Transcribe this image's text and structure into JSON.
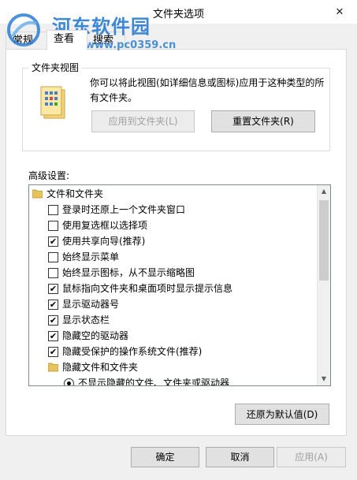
{
  "window": {
    "title": "文件夹选项",
    "close_glyph": "✕"
  },
  "watermark": {
    "text": "河东软件园",
    "url": "www.pc0359.cn"
  },
  "tabs": [
    {
      "label": "常规",
      "active": false
    },
    {
      "label": "查看",
      "active": true
    },
    {
      "label": "搜索",
      "active": false
    }
  ],
  "folder_views": {
    "legend": "文件夹视图",
    "description": "你可以将此视图(如详细信息或图标)应用于这种类型的所有文件夹。",
    "apply_button": "应用到文件夹(L)",
    "reset_button": "重置文件夹(R)"
  },
  "advanced": {
    "label": "高级设置:",
    "items": [
      {
        "type": "folder",
        "label": "文件和文件夹"
      },
      {
        "type": "checkbox",
        "label": "登录时还原上一个文件夹窗口",
        "checked": false
      },
      {
        "type": "checkbox",
        "label": "使用复选框以选择项",
        "checked": false
      },
      {
        "type": "checkbox",
        "label": "使用共享向导(推荐)",
        "checked": true
      },
      {
        "type": "checkbox",
        "label": "始终显示菜单",
        "checked": false
      },
      {
        "type": "checkbox",
        "label": "始终显示图标，从不显示缩略图",
        "checked": false
      },
      {
        "type": "checkbox",
        "label": "鼠标指向文件夹和桌面项时显示提示信息",
        "checked": true
      },
      {
        "type": "checkbox",
        "label": "显示驱动器号",
        "checked": true
      },
      {
        "type": "checkbox",
        "label": "显示状态栏",
        "checked": true
      },
      {
        "type": "checkbox",
        "label": "隐藏空的驱动器",
        "checked": true
      },
      {
        "type": "checkbox",
        "label": "隐藏受保护的操作系统文件(推荐)",
        "checked": true
      },
      {
        "type": "subfolder",
        "label": "隐藏文件和文件夹"
      },
      {
        "type": "radio",
        "label": "不显示隐藏的文件、文件夹或驱动器",
        "checked": true
      }
    ],
    "restore_button": "还原为默认值(D)"
  },
  "footer": {
    "ok": "确定",
    "cancel": "取消",
    "apply": "应用(A)"
  },
  "colors": {
    "watermark": "#2d7fd3",
    "folder": "#e8c25a"
  }
}
